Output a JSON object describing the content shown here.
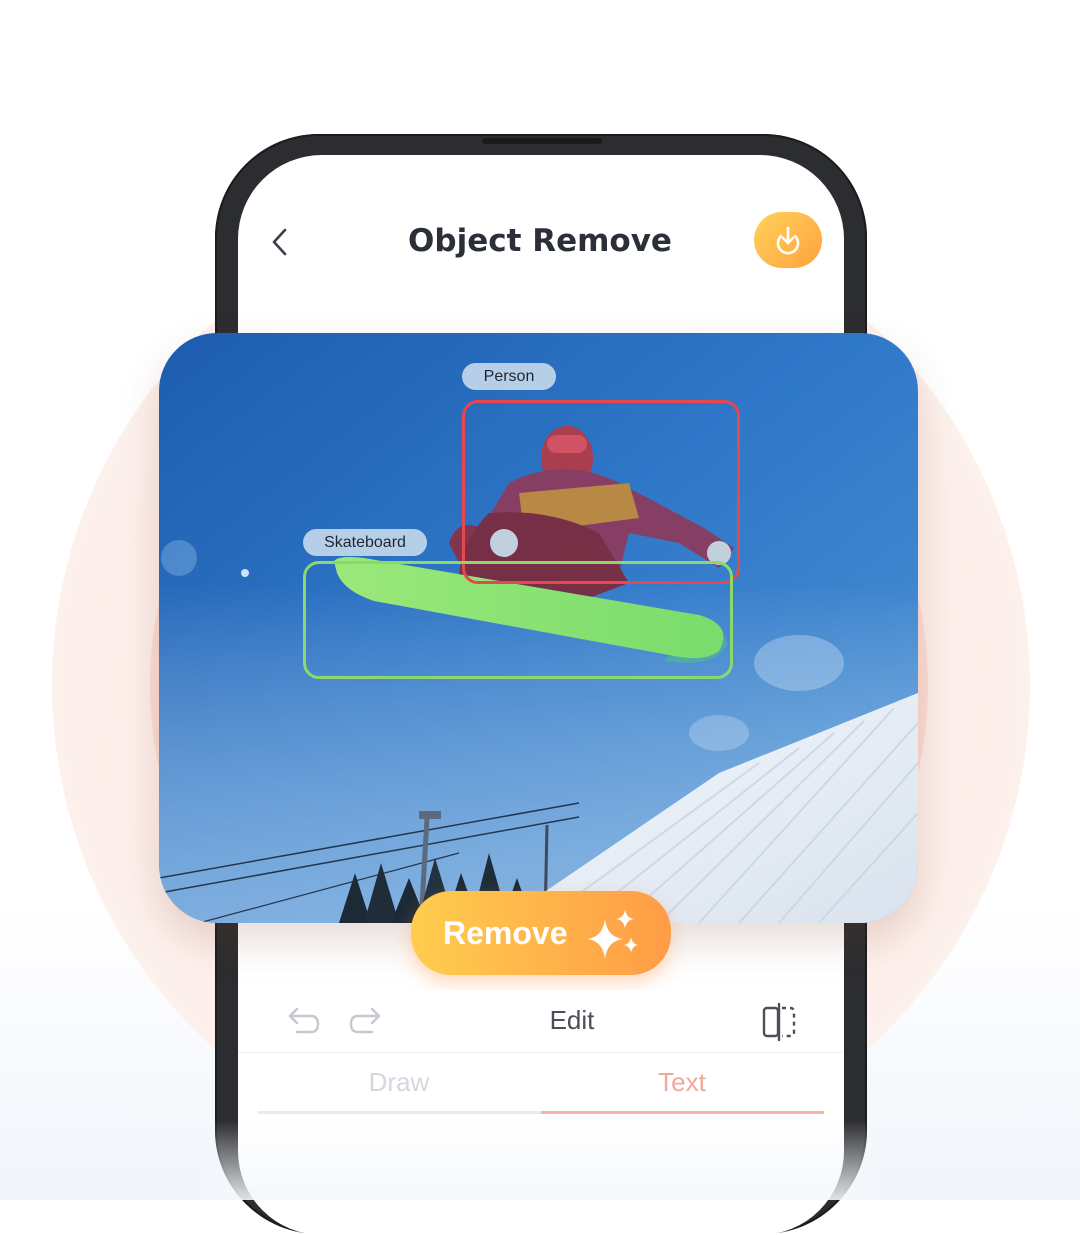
{
  "header": {
    "title": "Object Remove",
    "back_icon": "chevron-left-icon",
    "download_icon": "download-icon"
  },
  "detections": [
    {
      "label": "Person",
      "color": "#e5484d"
    },
    {
      "label": "Skateboard",
      "color": "#8bd96b"
    }
  ],
  "remove_button": {
    "label": "Remove",
    "icon": "sparkles-icon"
  },
  "toolbar": {
    "undo_icon": "undo-icon",
    "redo_icon": "redo-icon",
    "edit_label": "Edit",
    "compare_icon": "compare-icon"
  },
  "tabs": [
    {
      "label": "Draw",
      "active": false
    },
    {
      "label": "Text",
      "active": true
    }
  ],
  "colors": {
    "accent": "#ffa23d",
    "active_tab": "#f2a89a",
    "inactive_tab": "#d3d7de",
    "title": "#2b2f38"
  }
}
